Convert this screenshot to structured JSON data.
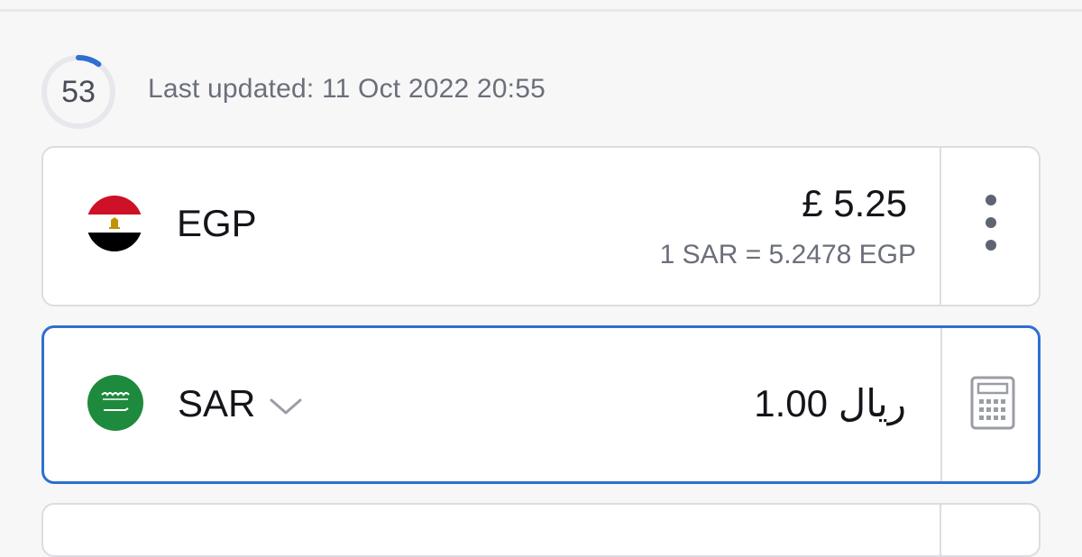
{
  "timer": {
    "value": "53",
    "progress": 0.1
  },
  "last_updated": {
    "text": "Last updated: 11 Oct 2022 20:55"
  },
  "rows": [
    {
      "code": "EGP",
      "amount": "£ 5.25",
      "rate": "1 SAR = 5.2478 EGP",
      "flag": "egypt-flag-icon",
      "action_icon": "more-vertical-icon"
    },
    {
      "code": "SAR",
      "amount": "1.00 ريال",
      "flag": "saudi-flag-icon",
      "action_icon": "calculator-icon",
      "selected": true
    }
  ],
  "colors": {
    "accent": "#2f6fd0",
    "text_primary": "#14151a",
    "text_secondary": "#6b6f7a",
    "background": "#f7f7f8",
    "card": "#ffffff",
    "border": "#dcdde1"
  }
}
